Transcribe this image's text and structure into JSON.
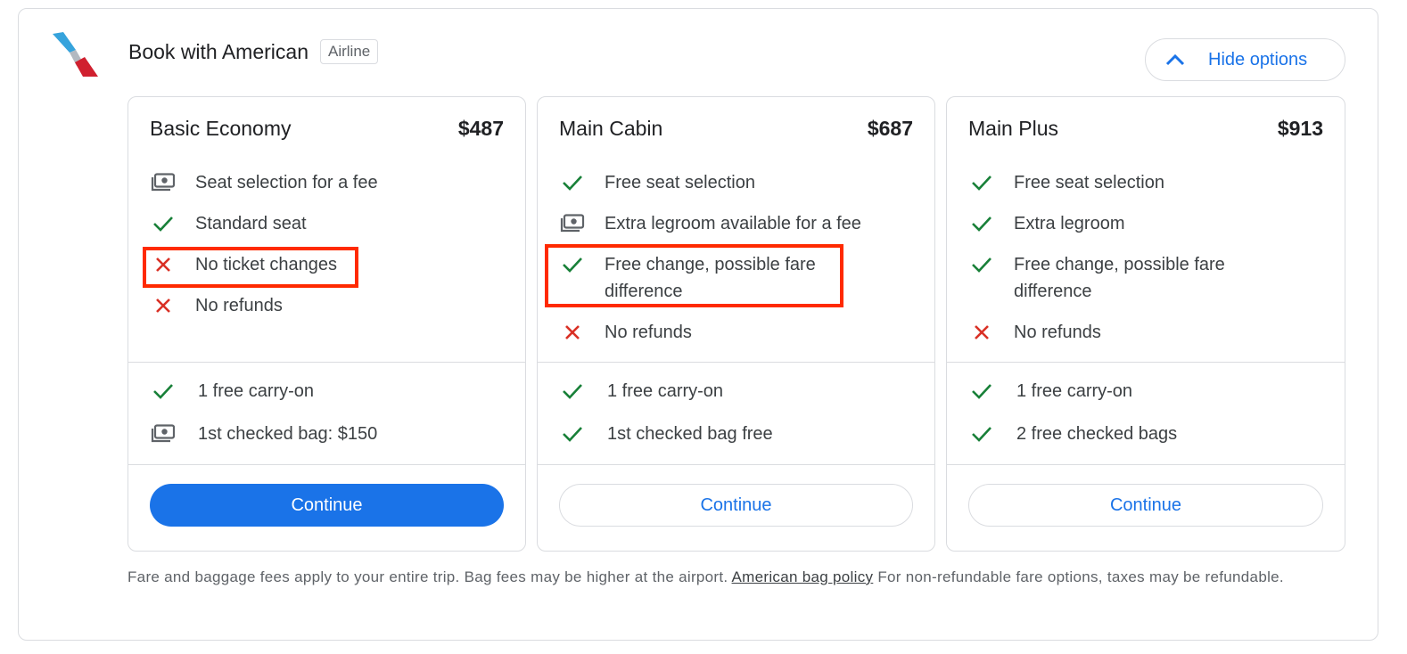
{
  "header": {
    "title": "Book with American",
    "badge": "Airline",
    "toggle_label": "Hide options"
  },
  "colors": {
    "accent": "#1a73e8",
    "check": "#188038",
    "cross": "#d93025",
    "highlight": "#ff2a00"
  },
  "fares": [
    {
      "name": "Basic Economy",
      "price": "$487",
      "features": [
        {
          "icon": "money-icon",
          "text": "Seat selection for a fee"
        },
        {
          "icon": "check-icon",
          "text": "Standard seat"
        },
        {
          "icon": "x-icon",
          "text": "No ticket changes"
        },
        {
          "icon": "x-icon",
          "text": "No refunds"
        }
      ],
      "bags": [
        {
          "icon": "check-icon",
          "text": "1 free carry-on"
        },
        {
          "icon": "money-icon",
          "text": "1st checked bag: $150"
        }
      ],
      "cta": "Continue"
    },
    {
      "name": "Main Cabin",
      "price": "$687",
      "features": [
        {
          "icon": "check-icon",
          "text": "Free seat selection"
        },
        {
          "icon": "money-icon",
          "text": "Extra legroom available for a fee"
        },
        {
          "icon": "check-icon",
          "text_line1": "Free change, possible fare",
          "text_line2": "difference"
        },
        {
          "icon": "x-icon",
          "text": "No refunds"
        }
      ],
      "bags": [
        {
          "icon": "check-icon",
          "text": "1 free carry-on"
        },
        {
          "icon": "check-icon",
          "text": "1st checked bag free"
        }
      ],
      "cta": "Continue"
    },
    {
      "name": "Main Plus",
      "price": "$913",
      "features": [
        {
          "icon": "check-icon",
          "text": "Free seat selection"
        },
        {
          "icon": "check-icon",
          "text": "Extra legroom"
        },
        {
          "icon": "check-icon",
          "text_line1": "Free change, possible fare",
          "text_line2": "difference"
        },
        {
          "icon": "x-icon",
          "text": "No refunds"
        }
      ],
      "bags": [
        {
          "icon": "check-icon",
          "text": "1 free carry-on"
        },
        {
          "icon": "check-icon",
          "text": "2 free checked bags"
        }
      ],
      "cta": "Continue"
    }
  ],
  "footnote": {
    "before_link": "Fare and baggage fees apply to your entire trip. Bag fees may be higher at the airport. ",
    "link": "American bag policy",
    "after_link": " For non-refundable fare options, taxes may be refundable."
  }
}
